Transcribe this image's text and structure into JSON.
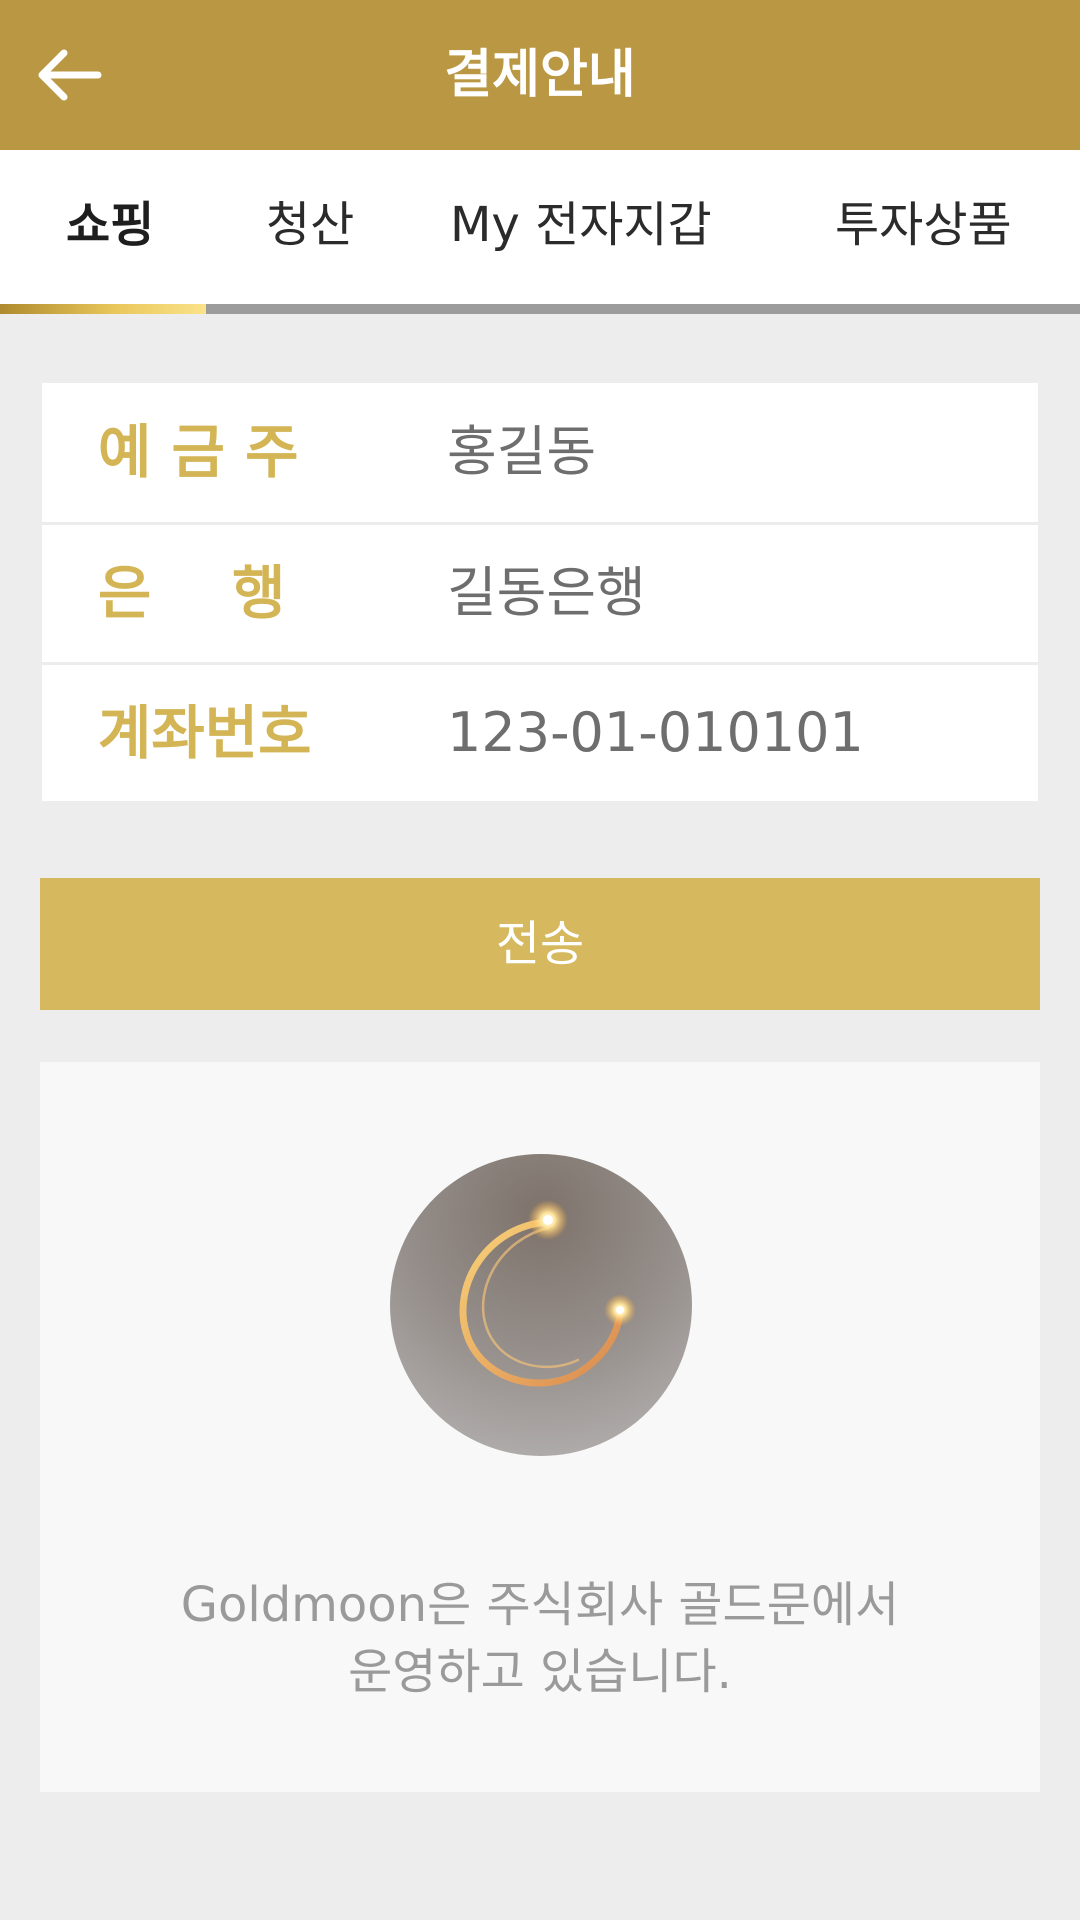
{
  "header": {
    "title": "결제안내",
    "back_icon": "arrow-left-icon",
    "color": "#b99743"
  },
  "tabs": [
    {
      "label": "쇼핑",
      "active": true
    },
    {
      "label": "청산",
      "active": false
    },
    {
      "label": "My 전자지갑",
      "active": false
    },
    {
      "label": "투자상품",
      "active": false
    }
  ],
  "account": {
    "rows": [
      {
        "label": "예 금 주",
        "value": "홍길동"
      },
      {
        "label": "은    행",
        "value": "길동은행"
      },
      {
        "label": "계좌번호",
        "value": "123-01-010101"
      }
    ],
    "label_color": "#d4b556"
  },
  "submit": {
    "label": "전송",
    "color": "#d6b95e"
  },
  "footer": {
    "logo_icon": "goldmoon-crescent-logo",
    "line1": "Goldmoon은 주식회사 골드문에서",
    "line2": "운영하고 있습니다."
  }
}
